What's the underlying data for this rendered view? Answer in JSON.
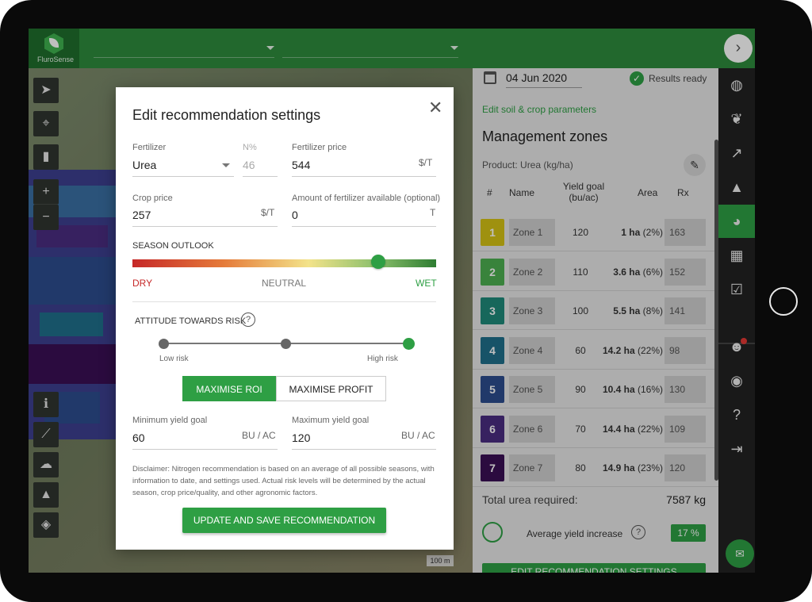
{
  "app": {
    "logo_text": "FluroSense"
  },
  "header": {
    "next_icon": "chevron-right-icon"
  },
  "map": {
    "scale_label": "100 m",
    "tools_top": [
      "location-arrow-icon",
      "crosshair-icon",
      "ruler-icon"
    ],
    "zoom_in": "+",
    "zoom_out": "−",
    "tools_bottom": [
      "info-icon",
      "polygon-draw-icon",
      "weather-icon",
      "warning-icon",
      "layers-icon"
    ]
  },
  "panel": {
    "date": "04 Jun 2020",
    "status": "Results ready",
    "edit_soil_link": "Edit soil & crop parameters",
    "title": "Management zones",
    "product": "Product: Urea (kg/ha)",
    "columns": {
      "num": "#",
      "name": "Name",
      "goal": "Yield goal (bu/ac)",
      "area": "Area",
      "rx": "Rx"
    },
    "zones": [
      {
        "num": "1",
        "name": "Zone 1",
        "goal": "120",
        "area_ha": "1 ha",
        "area_pct": "(2%)",
        "rx": "163",
        "color": "#d4c214"
      },
      {
        "num": "2",
        "name": "Zone 2",
        "goal": "110",
        "area_ha": "3.6 ha",
        "area_pct": "(6%)",
        "rx": "152",
        "color": "#4caf50"
      },
      {
        "num": "3",
        "name": "Zone 3",
        "goal": "100",
        "area_ha": "5.5 ha",
        "area_pct": "(8%)",
        "rx": "141",
        "color": "#1f8a7a"
      },
      {
        "num": "4",
        "name": "Zone 4",
        "goal": "60",
        "area_ha": "14.2 ha",
        "area_pct": "(22%)",
        "rx": "98",
        "color": "#1f6f8b"
      },
      {
        "num": "5",
        "name": "Zone 5",
        "goal": "90",
        "area_ha": "10.4 ha",
        "area_pct": "(16%)",
        "rx": "130",
        "color": "#2d4d8e"
      },
      {
        "num": "6",
        "name": "Zone 6",
        "goal": "70",
        "area_ha": "14.4 ha",
        "area_pct": "(22%)",
        "rx": "109",
        "color": "#4a2d80"
      },
      {
        "num": "7",
        "name": "Zone 7",
        "goal": "80",
        "area_ha": "14.9 ha",
        "area_pct": "(23%)",
        "rx": "120",
        "color": "#3a0f55"
      }
    ],
    "total_label": "Total urea required:",
    "total_value": "7587 kg",
    "yield_label": "Average yield increase",
    "yield_help": "?",
    "yield_value": "17 %",
    "bottom_button": "EDIT RECOMMENDATION SETTINGS"
  },
  "rail": {
    "items": [
      "satellite-icon",
      "crop-icon",
      "chart-icon",
      "alert-icon",
      "zones-icon",
      "gallery-icon",
      "check-icon",
      "team-icon",
      "account-icon",
      "help-icon",
      "logout-icon"
    ],
    "active_index": 4
  },
  "modal": {
    "title": "Edit recommendation settings",
    "close": "✕",
    "fertilizer": {
      "label": "Fertilizer",
      "value": "Urea"
    },
    "n_pct": {
      "label": "N%",
      "value": "46"
    },
    "fert_price": {
      "label": "Fertilizer price",
      "value": "544",
      "unit": "$/T"
    },
    "crop_price": {
      "label": "Crop price",
      "value": "257",
      "unit": "$/T"
    },
    "fert_available": {
      "label": "Amount of fertilizer available (optional)",
      "value": "0",
      "unit": "T"
    },
    "season": {
      "title": "SEASON OUTLOOK",
      "dry": "DRY",
      "neutral": "NEUTRAL",
      "wet": "WET",
      "level": 0.81
    },
    "risk": {
      "title": "ATTITUDE TOWARDS RISK",
      "help": "?",
      "low": "Low risk",
      "high": "High risk",
      "selected": 3
    },
    "toggle": {
      "roi": "MAXIMISE ROI",
      "profit": "MAXIMISE PROFIT",
      "selected": "roi"
    },
    "min_yield": {
      "label": "Minimum yield goal",
      "value": "60",
      "unit": "BU / AC"
    },
    "max_yield": {
      "label": "Maximum yield goal",
      "value": "120",
      "unit": "BU / AC"
    },
    "disclaimer": "Disclaimer: Nitrogen recommendation is based on an average of all possible seasons, with information to date, and settings used. Actual risk levels will be determined by the actual season, crop price/quality, and other agronomic factors.",
    "save_button": "UPDATE AND SAVE RECOMMENDATION"
  }
}
